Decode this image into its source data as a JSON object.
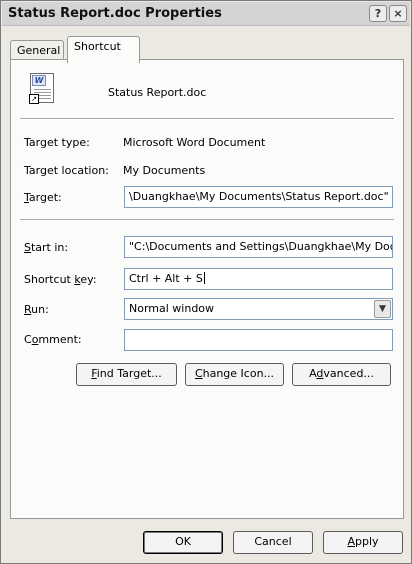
{
  "window": {
    "title": "Status Report.doc Properties",
    "help_icon": "?",
    "close_icon": "×"
  },
  "tabs": [
    {
      "label": "General",
      "active": false
    },
    {
      "label": "Shortcut",
      "active": true
    }
  ],
  "file": {
    "icon": "word-document-shortcut-icon",
    "name": "Status Report.doc"
  },
  "info": {
    "target_type_label": "Target type:",
    "target_type_value": "Microsoft Word Document",
    "target_location_label": "Target location:",
    "target_location_value": "My Documents"
  },
  "fields": {
    "target_label_mn": "T",
    "target_label_rest": "arget:",
    "target_value": "\\Duangkhae\\My Documents\\Status Report.doc\"",
    "start_in_label_mn": "S",
    "start_in_label_rest": "tart in:",
    "start_in_value": "\"C:\\Documents and Settings\\Duangkhae\\My Doс",
    "shortcut_key_label_pre": "Shortcut ",
    "shortcut_key_label_mn": "k",
    "shortcut_key_label_rest": "ey:",
    "shortcut_key_value": "Ctrl + Alt + S",
    "run_label_mn": "R",
    "run_label_rest": "un:",
    "run_value": "Normal window",
    "comment_label_pre": "C",
    "comment_label_mn": "o",
    "comment_label_rest": "mment:",
    "comment_value": ""
  },
  "actions": {
    "find_target_mn": "F",
    "find_target_rest": "ind Target...",
    "change_icon_mn": "C",
    "change_icon_rest": "hange Icon...",
    "advanced_pre": "A",
    "advanced_mn": "d",
    "advanced_rest": "vanced..."
  },
  "dialog_buttons": {
    "ok": "OK",
    "cancel": "Cancel",
    "apply_mn": "A",
    "apply_rest": "pply"
  }
}
